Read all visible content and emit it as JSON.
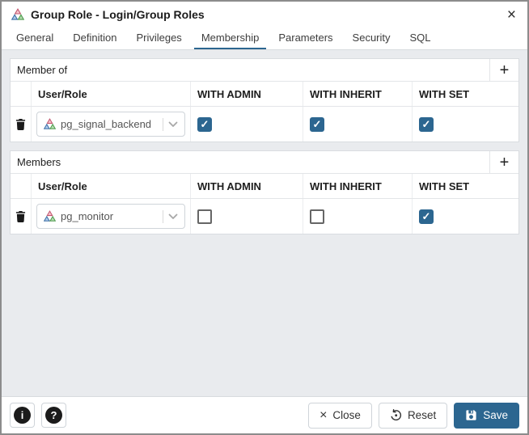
{
  "window": {
    "title": "Group Role - Login/Group Roles",
    "close_icon": "×"
  },
  "tabs": {
    "active": "Membership",
    "items": [
      "General",
      "Definition",
      "Privileges",
      "Membership",
      "Parameters",
      "Security",
      "SQL"
    ]
  },
  "colors": {
    "accent": "#2c6690",
    "checkbox_checked": "#2c6690",
    "content_bg": "#e9ebee"
  },
  "sections": [
    {
      "title": "Member of",
      "add_icon": "+",
      "columns": [
        "User/Role",
        "WITH ADMIN",
        "WITH INHERIT",
        "WITH SET"
      ],
      "rows": [
        {
          "role": "pg_signal_backend",
          "with_admin": true,
          "with_inherit": true,
          "with_set": true
        }
      ]
    },
    {
      "title": "Members",
      "add_icon": "+",
      "columns": [
        "User/Role",
        "WITH ADMIN",
        "WITH INHERIT",
        "WITH SET"
      ],
      "rows": [
        {
          "role": "pg_monitor",
          "with_admin": false,
          "with_inherit": false,
          "with_set": true
        }
      ]
    }
  ],
  "footer": {
    "info_icon": "i",
    "help_icon": "?",
    "close_label": "Close",
    "reset_label": "Reset",
    "save_label": "Save",
    "close_icon": "×"
  }
}
